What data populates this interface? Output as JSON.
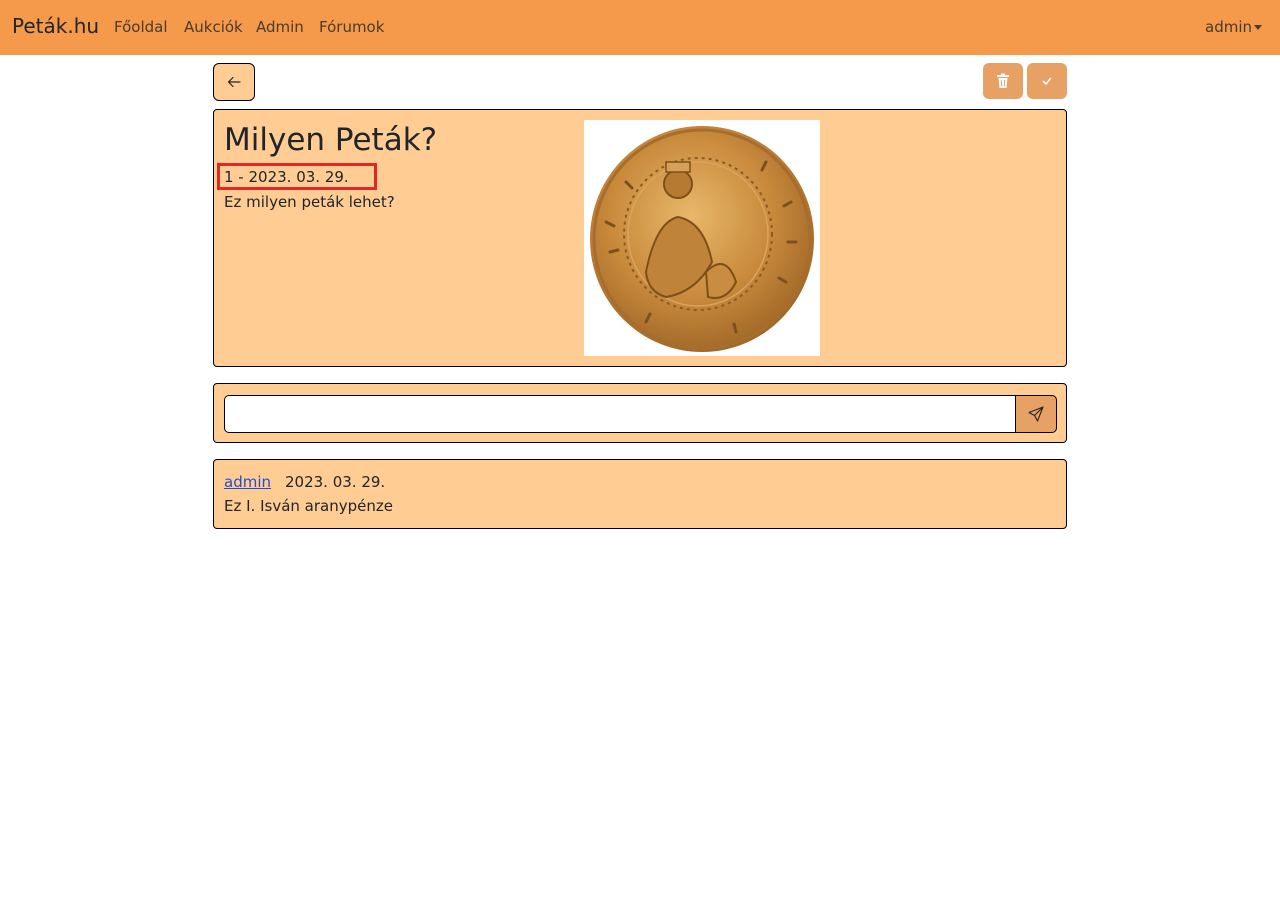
{
  "navbar": {
    "brand": "Peták.hu",
    "links": [
      "Főoldal",
      "Aukciók",
      "Admin",
      "Fórumok"
    ],
    "user": "admin"
  },
  "toolbar": {
    "back_icon": "arrow-left-icon",
    "delete_icon": "trash-icon",
    "confirm_icon": "check-icon"
  },
  "post": {
    "title": "Milyen Peták?",
    "meta": "1 - 2023. 03. 29.",
    "body": "Ez milyen peták lehet?",
    "image": "gold-coin-image"
  },
  "comment_form": {
    "input_value": "",
    "send_icon": "send-icon"
  },
  "comments": [
    {
      "author": "admin",
      "date": "2023. 03. 29.",
      "text": "Ez I. Isván aranypénze"
    }
  ],
  "colors": {
    "navbar": "#f5994a",
    "card": "#ffcc94",
    "button": "#e8a165",
    "highlight": "#e32626",
    "link": "#1d4fd6"
  }
}
